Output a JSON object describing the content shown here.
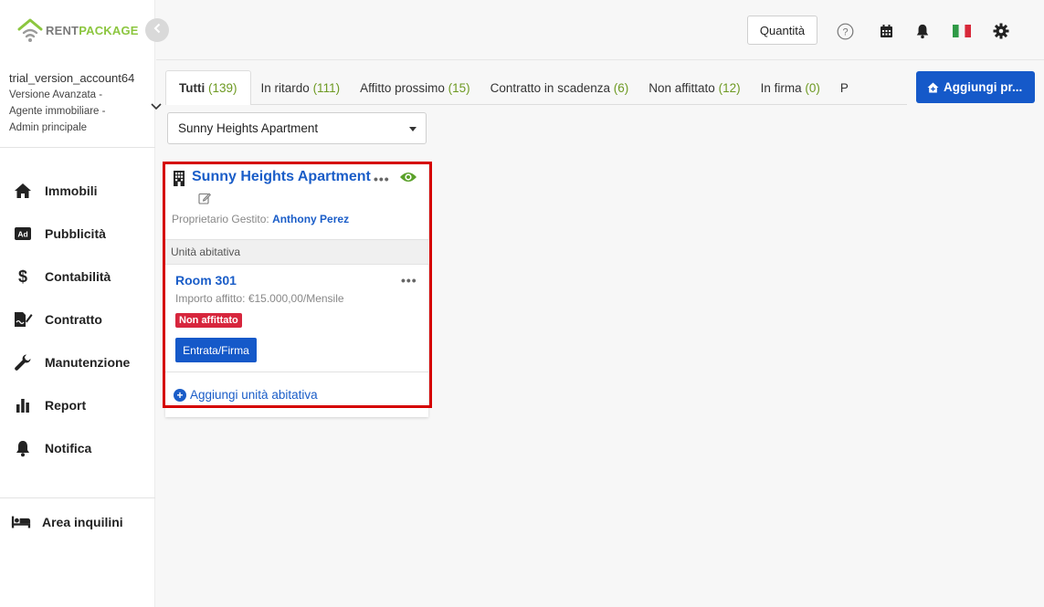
{
  "brand": {
    "rent": "RENT",
    "package": "PACKAGE"
  },
  "account": {
    "name": "trial_version_account64",
    "description_lines": [
      "Versione Avanzata -",
      "Agente immobiliare -",
      "Admin principale"
    ]
  },
  "sidebar": {
    "items": [
      {
        "label": "Immobili",
        "icon": "home-icon"
      },
      {
        "label": "Pubblicità",
        "icon": "ad-icon"
      },
      {
        "label": "Contabilità",
        "icon": "dollar-icon"
      },
      {
        "label": "Contratto",
        "icon": "contract-sign-icon"
      },
      {
        "label": "Manutenzione",
        "icon": "wrench-icon"
      },
      {
        "label": "Report",
        "icon": "bar-chart-icon"
      },
      {
        "label": "Notifica",
        "icon": "bell-icon"
      }
    ],
    "tenant_area": {
      "label": "Area inquilini",
      "icon": "bed-icon"
    }
  },
  "topbar": {
    "quantity_label": "Quantità",
    "icons": [
      "help-icon",
      "calendar-icon",
      "bell-icon",
      "italy-flag-icon",
      "gear-icon"
    ]
  },
  "tabs": [
    {
      "label": "Tutti",
      "count": "(139)",
      "active": true
    },
    {
      "label": "In ritardo",
      "count": "(111)"
    },
    {
      "label": "Affitto prossimo",
      "count": "(15)"
    },
    {
      "label": "Contratto in scadenza",
      "count": "(6)"
    },
    {
      "label": "Non affittato",
      "count": "(12)"
    },
    {
      "label": "In firma",
      "count": "(0)"
    },
    {
      "label": "P",
      "count": ""
    }
  ],
  "add_property_label": "Aggiungi pr...",
  "property_select": {
    "value": "Sunny Heights Apartment"
  },
  "property_card": {
    "title": "Sunny Heights Apartment",
    "owner_label": "Proprietario Gestito:",
    "owner_name": "Anthony Perez",
    "unit_section_label": "Unità abitativa",
    "unit": {
      "name": "Room 301",
      "rent_text": "Importo affitto: €15.000,00/Mensile",
      "status": "Non affittato",
      "action_label": "Entrata/Firma"
    },
    "add_unit_label": "Aggiungi unità abitativa"
  },
  "colors": {
    "accent_blue": "#1559c9",
    "link_blue": "#1a5dc8",
    "brand_green": "#8cc63f",
    "count_green": "#6e9a23",
    "badge_red": "#d7263d",
    "highlight_red": "#d50000"
  }
}
